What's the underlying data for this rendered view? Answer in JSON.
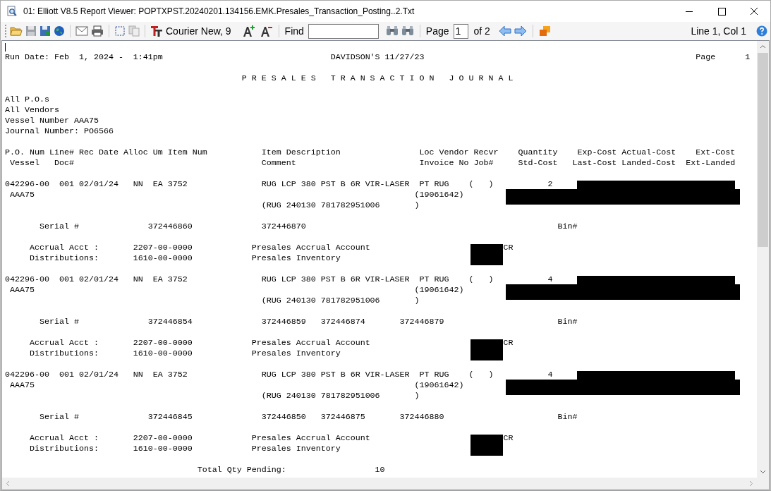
{
  "window": {
    "title": "01: Elliott V8.5 Report Viewer: POPTXPST.20240201.134156.EMK.Presales_Transaction_Posting..2.Txt"
  },
  "toolbar": {
    "font": "Courier New, 9",
    "find_label": "Find",
    "page_label": "Page",
    "page_value": "1",
    "page_total": "of 2",
    "position": "Line 1, Col 1"
  },
  "report": {
    "blocks": [
      [
        {
          "text": "Run Date: Feb  1, 2024 -  1:41pm                                  DAVIDSON'S 11/27/23                                                       Page      1"
        }
      ],
      [
        {
          "text": "                                                P R E S A L E S   T R A N S A C T I O N   J O U R N A L"
        }
      ],
      [
        {
          "text": "All P.O.s"
        },
        {
          "text": "All Vendors"
        },
        {
          "text": "Vessel Number AAA75"
        },
        {
          "text": "Journal Number: PO6566"
        }
      ],
      [
        {
          "text": "P.O. Num Line# Rec Date Alloc Um Item Num           Item Description                Loc Vendor Recvr    Quantity    Exp-Cost Actual-Cost    Ext-Cost"
        },
        {
          "text": " Vessel   Doc#                                      Comment                         Invoice No Job#     Std-Cost   Last-Cost Landed-Cost  Ext-Landed"
        }
      ],
      [
        {
          "kind": "cost-upper",
          "text": "042296-00  001 02/01/24   NN  EA 3752               RUG LCP 380 PST B 6R VIR-LASER  PT RUG    (   )           2"
        },
        {
          "kind": "cost-lower",
          "text": " AAA75                                                                             (19061642)"
        },
        {
          "text": "                                                    (RUG 240130 781782951006       )"
        }
      ],
      [
        {
          "text": "       Serial #              372446860              372446870                                                   Bin#"
        }
      ],
      [
        {
          "kind": "account",
          "text": "     Accrual Acct :       2207-00-0000            Presales Accrual Account                           CR"
        },
        {
          "text": "     Distributions:       1610-00-0000            Presales Inventory"
        }
      ],
      [
        {
          "kind": "cost-upper",
          "text": "042296-00  001 02/01/24   NN  EA 3752               RUG LCP 380 PST B 6R VIR-LASER  PT RUG    (   )           4"
        },
        {
          "kind": "cost-lower",
          "text": " AAA75                                                                             (19061642)"
        },
        {
          "text": "                                                    (RUG 240130 781782951006       )"
        }
      ],
      [
        {
          "text": "       Serial #              372446854              372446859   372446874       372446879                       Bin#"
        }
      ],
      [
        {
          "kind": "account",
          "text": "     Accrual Acct :       2207-00-0000            Presales Accrual Account                           CR"
        },
        {
          "text": "     Distributions:       1610-00-0000            Presales Inventory"
        }
      ],
      [
        {
          "kind": "cost-upper",
          "text": "042296-00  001 02/01/24   NN  EA 3752               RUG LCP 380 PST B 6R VIR-LASER  PT RUG    (   )           4"
        },
        {
          "kind": "cost-lower",
          "text": " AAA75                                                                             (19061642)"
        },
        {
          "text": "                                                    (RUG 240130 781782951006       )"
        }
      ],
      [
        {
          "text": "       Serial #              372446845              372446850   372446875       372446880                       Bin#"
        }
      ],
      [
        {
          "kind": "account",
          "text": "     Accrual Acct :       2207-00-0000            Presales Accrual Account                           CR"
        },
        {
          "text": "     Distributions:       1610-00-0000            Presales Inventory"
        }
      ],
      [
        {
          "text": "                                       Total Qty Pending:                  10"
        }
      ]
    ]
  }
}
